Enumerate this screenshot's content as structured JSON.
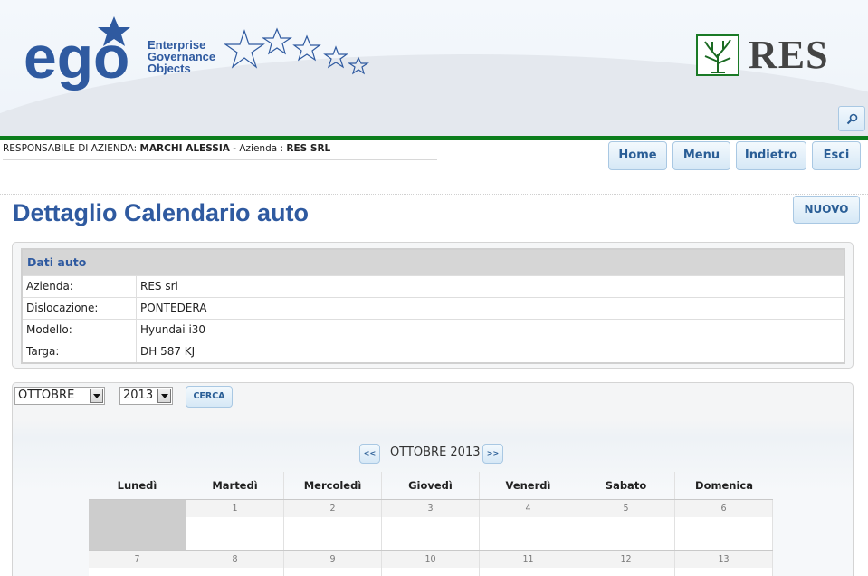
{
  "header": {
    "logo_left_word": "ego",
    "logo_left_lines": [
      "Enterprise",
      "Governance",
      "Objects"
    ],
    "logo_right_word": "RES"
  },
  "user_info": {
    "role_label": "RESPONSABILE DI AZIENDA:",
    "user_name": "MARCHI ALESSIA",
    "company_label": " - Azienda : ",
    "company_name": "RES SRL"
  },
  "nav": {
    "home": "Home",
    "menu": "Menu",
    "back": "Indietro",
    "exit": "Esci"
  },
  "page": {
    "title": "Dettaglio Calendario auto",
    "new_label": "NUOVO"
  },
  "auto": {
    "section_title": "Dati auto",
    "rows": [
      {
        "label": "Azienda:",
        "value": "RES srl"
      },
      {
        "label": "Dislocazione:",
        "value": "PONTEDERA"
      },
      {
        "label": "Modello:",
        "value": "Hyundai i30"
      },
      {
        "label": "Targa:",
        "value": "DH 587 KJ"
      }
    ]
  },
  "filter": {
    "month_selected": "OTTOBRE",
    "year_selected": "2013",
    "search_label": "CERCA"
  },
  "calendar": {
    "prev_label": "<<",
    "next_label": ">>",
    "month_label": "OTTOBRE 2013",
    "weekdays": [
      "Lunedì",
      "Martedì",
      "Mercoledì",
      "Giovedì",
      "Venerdì",
      "Sabato",
      "Domenica"
    ],
    "weeks": [
      [
        "",
        "1",
        "2",
        "3",
        "4",
        "5",
        "6"
      ],
      [
        "7",
        "8",
        "9",
        "10",
        "11",
        "12",
        "13"
      ]
    ]
  },
  "colors": {
    "brand_blue": "#2f5aa0",
    "brand_green": "#0b7d1b"
  }
}
